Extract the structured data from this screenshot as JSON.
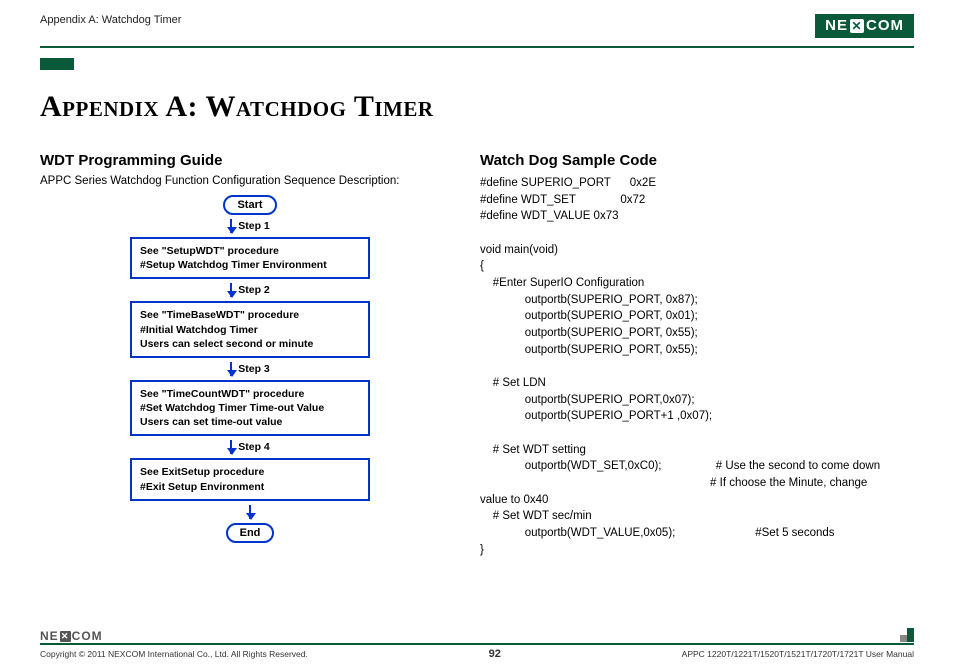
{
  "header": {
    "breadcrumb": "Appendix A: Watchdog Timer",
    "brand": "NEXCOM"
  },
  "title": "Appendix A: Watchdog Timer",
  "left": {
    "heading": "WDT Programming Guide",
    "desc": "APPC Series Watchdog Function Configuration Sequence Description:",
    "start": "Start",
    "end": "End",
    "steps": {
      "s1": "Step 1",
      "s2": "Step 2",
      "s3": "Step 3",
      "s4": "Step 4"
    },
    "box1": {
      "l1": "See \"SetupWDT\" procedure",
      "l2": "#Setup Watchdog Timer Environment"
    },
    "box2": {
      "l1": "See \"TimeBaseWDT\" procedure",
      "l2": "#Initial Watchdog Timer",
      "l3": "Users can select second or minute"
    },
    "box3": {
      "l1": "See \"TimeCountWDT\" procedure",
      "l2": "#Set Watchdog Timer Time-out Value",
      "l3": "Users can set time-out value"
    },
    "box4": {
      "l1": "See ExitSetup procedure",
      "l2": "#Exit Setup Environment"
    }
  },
  "right": {
    "heading": "Watch Dog Sample Code",
    "code": "#define SUPERIO_PORT      0x2E\n#define WDT_SET              0x72\n#define WDT_VALUE 0x73\n\nvoid main(void)\n{\n    #Enter SuperIO Configuration\n              outportb(SUPERIO_PORT, 0x87);\n              outportb(SUPERIO_PORT, 0x01);\n              outportb(SUPERIO_PORT, 0x55);\n              outportb(SUPERIO_PORT, 0x55);\n\n    # Set LDN\n              outportb(SUPERIO_PORT,0x07);\n              outportb(SUPERIO_PORT+1 ,0x07);\n\n    # Set WDT setting\n              outportb(WDT_SET,0xC0);                 # Use the second to come down\n                                                                        # If choose the Minute, change\nvalue to 0x40\n    # Set WDT sec/min\n              outportb(WDT_VALUE,0x05);                         #Set 5 seconds\n}"
  },
  "footer": {
    "copyright": "Copyright © 2011 NEXCOM International Co., Ltd. All Rights Reserved.",
    "page": "92",
    "manual": "APPC 1220T/1221T/1520T/1521T/1720T/1721T User Manual"
  }
}
